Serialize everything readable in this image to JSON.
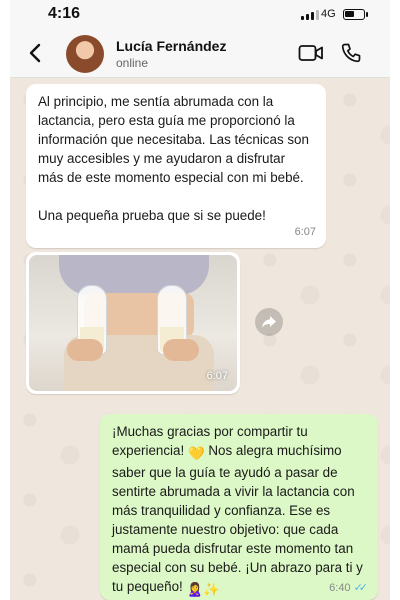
{
  "status_bar": {
    "time": "4:16",
    "network": "4G",
    "battery_level": 0.55
  },
  "header": {
    "contact_name": "Lucía Fernández",
    "contact_status": "online",
    "icons": [
      "back-icon",
      "avatar",
      "video-call-icon",
      "voice-call-icon"
    ]
  },
  "messages": [
    {
      "direction": "incoming",
      "paragraphs": [
        "Al principio, me sentía abrumada con la lactancia, pero esta guía me proporcionó la información que necesitaba. Las técnicas son muy accesibles y me ayudaron a disfrutar más de este momento especial con mi bebé.",
        "Una pequeña prueba que si se puede!"
      ],
      "time": "6:07"
    },
    {
      "direction": "incoming",
      "type": "image",
      "time": "6:07"
    },
    {
      "direction": "outgoing",
      "text_before_heart": "¡Muchas gracias por compartir tu experiencia!",
      "text_after_heart": "Nos alegra muchísimo saber que la guía te ayudó a pasar de sentirte abrumada a vivir la lactancia con más tranquilidad y confianza. Ese es justamente nuestro objetivo: que cada mamá pueda disfrutar este momento tan especial con su bebé. ¡Un abrazo para ti y tu pequeño!",
      "emoji_heart": "💛",
      "emoji_end": "🙎‍♀️✨",
      "time": "6:40",
      "read_status": "✓✓"
    }
  ],
  "colors": {
    "incoming_bubble": "#ffffff",
    "outgoing_bubble": "#dcf8c6",
    "read_tick": "#4fb6ec"
  }
}
